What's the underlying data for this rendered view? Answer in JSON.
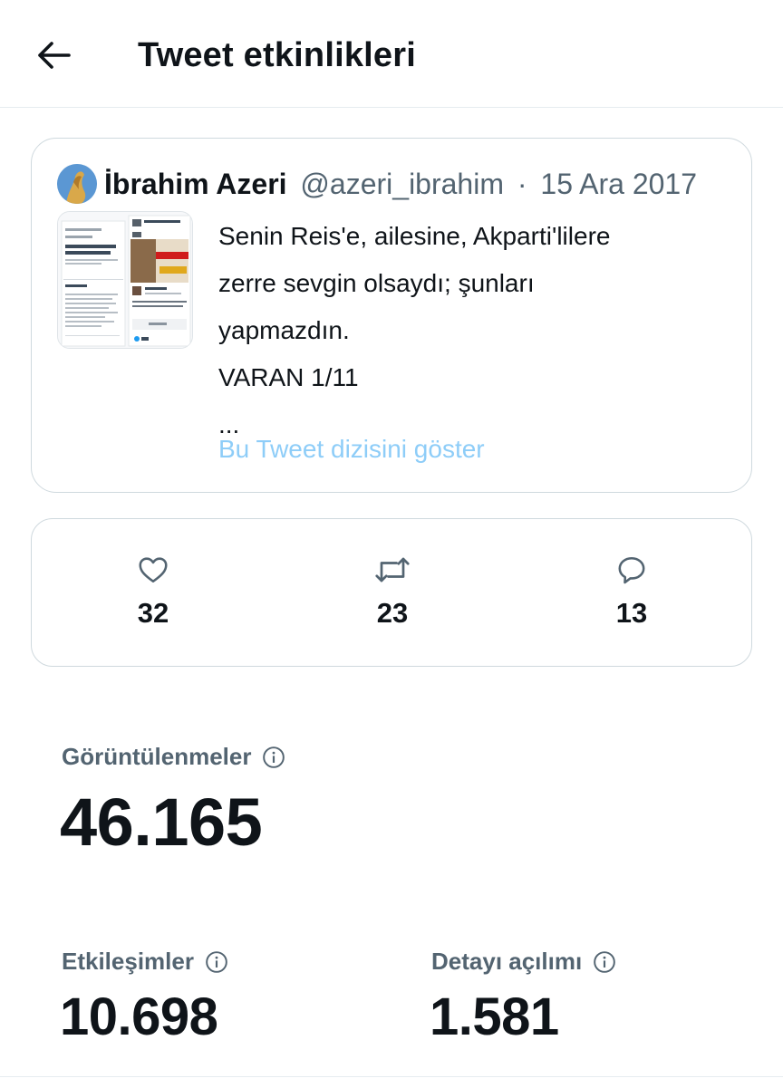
{
  "header": {
    "title": "Tweet etkinlikleri",
    "back_icon": "arrow-left-icon"
  },
  "tweet": {
    "author_name": "İbrahim Azeri",
    "author_handle": "@azeri_ibrahim",
    "separator": "·",
    "date": "15 Ara 2017",
    "text_lines": [
      "Senin Reis'e, ailesine, Akparti'lilere",
      "zerre sevgin olsaydı; şunları",
      "yapmazdın.",
      "VARAN 1/11",
      "..."
    ],
    "show_thread": "Bu Tweet dizisini göster"
  },
  "engagement": {
    "likes": {
      "icon": "heart-icon",
      "count": "32"
    },
    "retweets": {
      "icon": "retweet-icon",
      "count": "23"
    },
    "replies": {
      "icon": "reply-icon",
      "count": "13"
    }
  },
  "metrics": {
    "impressions": {
      "label": "Görüntülenmeler",
      "value": "46.165",
      "icon": "info-icon"
    },
    "engagements": {
      "label": "Etkileşimler",
      "value": "10.698",
      "icon": "info-icon"
    },
    "detail_expands": {
      "label": "Detayı açılımı",
      "value": "1.581",
      "icon": "info-icon"
    }
  },
  "colors": {
    "text": "#0f1419",
    "secondary": "#536471",
    "link": "#8ecdf8",
    "border": "#cfd9de"
  }
}
